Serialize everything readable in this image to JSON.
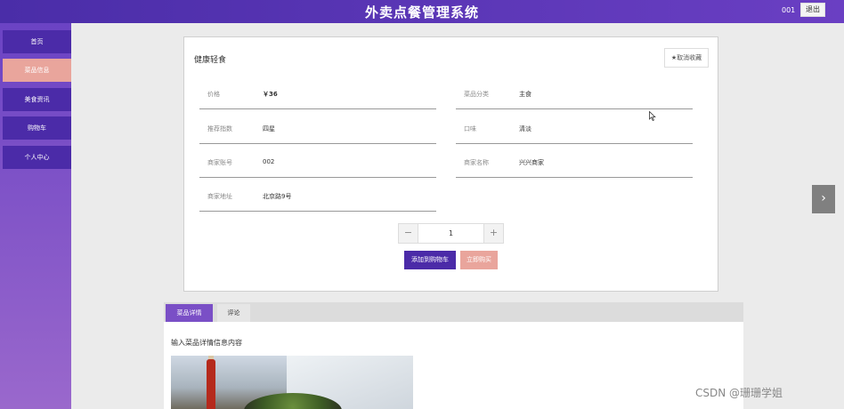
{
  "header": {
    "title": "外卖点餐管理系统",
    "user_id": "001",
    "logout_label": "退出"
  },
  "sidebar": {
    "items": [
      {
        "label": "首页"
      },
      {
        "label": "菜品信息",
        "active": true
      },
      {
        "label": "美食资讯"
      },
      {
        "label": "购物车"
      },
      {
        "label": "个人中心"
      }
    ]
  },
  "product": {
    "name": "健康轻食",
    "favorite_label": "★取消收藏",
    "fields": [
      {
        "label": "价格",
        "value": "￥36"
      },
      {
        "label": "菜品分类",
        "value": "主食"
      },
      {
        "label": "推荐指数",
        "value": "四星"
      },
      {
        "label": "口味",
        "value": "清淡"
      },
      {
        "label": "商家账号",
        "value": "002"
      },
      {
        "label": "商家名称",
        "value": "兴兴商家"
      },
      {
        "label": "商家地址",
        "value": "北京路9号"
      }
    ],
    "quantity": {
      "minus": "−",
      "value": "1",
      "plus": "+"
    },
    "add_to_cart_label": "添加到购物车",
    "buy_now_label": "立即购买"
  },
  "tabs": {
    "items": [
      {
        "label": "菜品详情",
        "active": true
      },
      {
        "label": "评论"
      }
    ],
    "content_text": "输入菜品详情信息内容"
  },
  "nav": {
    "next_icon": "›"
  },
  "watermark": "CSDN @珊珊学姐",
  "colors": {
    "primary": "#4b2ba8",
    "accent": "#e9a59c",
    "header_start": "#4a2da8",
    "header_end": "#6a3fc3"
  }
}
